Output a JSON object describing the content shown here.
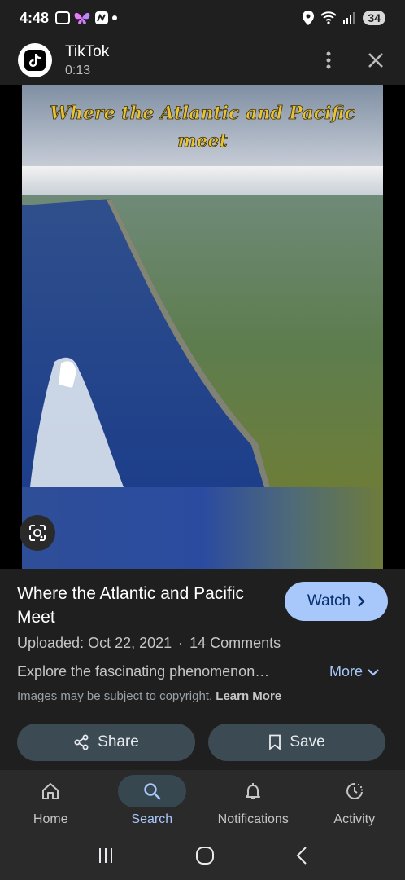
{
  "status_bar": {
    "time": "4:48",
    "battery": "34",
    "icons": [
      "screenshot-icon",
      "butterfly-icon",
      "nfc-app-icon",
      "dot-icon",
      "location-icon",
      "wifi-icon",
      "signal-icon",
      "battery-icon"
    ]
  },
  "header": {
    "app_name": "TikTok",
    "elapsed": "0:13",
    "icons": [
      "tiktok-logo",
      "more-vert-icon",
      "close-icon"
    ]
  },
  "media": {
    "overlay_text": "Where the Atlantic and Pacific meet"
  },
  "details": {
    "title": "Where the Atlantic and Pacific Meet",
    "watch_label": "Watch",
    "uploaded": "Uploaded: Oct 22, 2021",
    "separator": "·",
    "comments": "14 Comments",
    "description": "Explore the fascinating phenomenon…",
    "more_label": "More",
    "copyright": "Images may be subject to copyright.",
    "learn_more": "Learn More",
    "share_label": "Share",
    "save_label": "Save"
  },
  "bottom_nav": {
    "items": [
      {
        "label": "Home",
        "icon": "home-icon"
      },
      {
        "label": "Search",
        "icon": "search-icon"
      },
      {
        "label": "Notifications",
        "icon": "bell-icon"
      },
      {
        "label": "Activity",
        "icon": "activity-icon"
      }
    ],
    "active": "Search"
  },
  "colors": {
    "background": "#1f1f1f",
    "accent": "#a8c7fa",
    "button_dark": "#3c4a54",
    "nav_bg": "#2a2a2a"
  }
}
